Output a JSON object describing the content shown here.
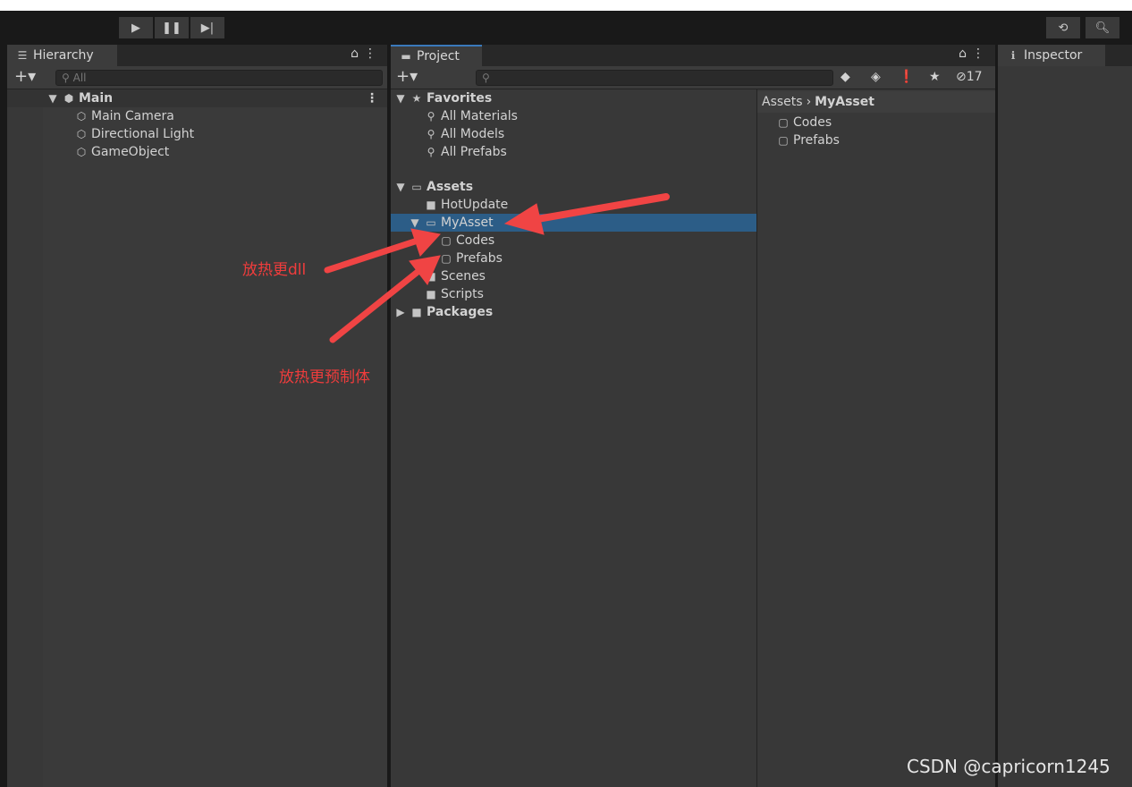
{
  "toolbar": {
    "play": "▶",
    "pause": "❚❚",
    "step": "▶|"
  },
  "hierarchy": {
    "tab": "Hierarchy",
    "search_placeholder": "All",
    "scene": "Main",
    "items": [
      "Main Camera",
      "Directional Light",
      "GameObject"
    ]
  },
  "project": {
    "tab": "Project",
    "hidden_count": "17",
    "favorites": {
      "label": "Favorites",
      "items": [
        "All Materials",
        "All Models",
        "All Prefabs"
      ]
    },
    "assets": {
      "label": "Assets",
      "items": [
        "HotUpdate",
        "MyAsset",
        "Codes",
        "Prefabs",
        "Scenes",
        "Scripts"
      ]
    },
    "packages": "Packages",
    "breadcrumb": {
      "root": "Assets",
      "current": "MyAsset"
    },
    "contents": [
      "Codes",
      "Prefabs"
    ]
  },
  "inspector": {
    "tab": "Inspector"
  },
  "annotations": {
    "dll": "放热更dll",
    "prefab": "放热更预制体",
    "accent": "#f03c3c"
  },
  "watermark": "CSDN @capricorn1245"
}
